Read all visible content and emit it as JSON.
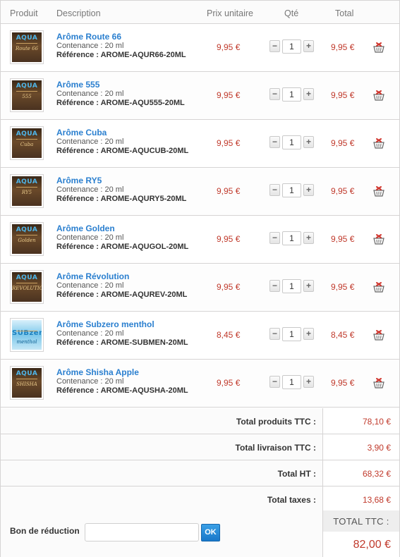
{
  "header": {
    "product": "Produit",
    "description": "Description",
    "unit_price": "Prix unitaire",
    "qty": "Qté",
    "total": "Total"
  },
  "labels": {
    "contenance_prefix": "Contenance : ",
    "reference_prefix": "Référence : "
  },
  "items": [
    {
      "name": "Arôme Route 66",
      "contenance": "20 ml",
      "reference": "AROME-AQUR66-20ML",
      "unit_price": "9,95 €",
      "qty": "1",
      "total": "9,95 €",
      "thumb_brand": "AQUA",
      "thumb_flavor": "Route 66"
    },
    {
      "name": "Arôme 555",
      "contenance": "20 ml",
      "reference": "AROME-AQU555-20ML",
      "unit_price": "9,95 €",
      "qty": "1",
      "total": "9,95 €",
      "thumb_brand": "AQUA",
      "thumb_flavor": "555"
    },
    {
      "name": "Arôme Cuba",
      "contenance": "20 ml",
      "reference": "AROME-AQUCUB-20ML",
      "unit_price": "9,95 €",
      "qty": "1",
      "total": "9,95 €",
      "thumb_brand": "AQUA",
      "thumb_flavor": "Cuba"
    },
    {
      "name": "Arôme RY5",
      "contenance": "20 ml",
      "reference": "AROME-AQURY5-20ML",
      "unit_price": "9,95 €",
      "qty": "1",
      "total": "9,95 €",
      "thumb_brand": "AQUA",
      "thumb_flavor": "RY5"
    },
    {
      "name": "Arôme Golden",
      "contenance": "20 ml",
      "reference": "AROME-AQUGOL-20ML",
      "unit_price": "9,95 €",
      "qty": "1",
      "total": "9,95 €",
      "thumb_brand": "AQUA",
      "thumb_flavor": "Golden"
    },
    {
      "name": "Arôme Révolution",
      "contenance": "20 ml",
      "reference": "AROME-AQUREV-20ML",
      "unit_price": "9,95 €",
      "qty": "1",
      "total": "9,95 €",
      "thumb_brand": "AQUA",
      "thumb_flavor": "REVOLUTION"
    },
    {
      "name": "Arôme Subzero menthol",
      "contenance": "20 ml",
      "reference": "AROME-SUBMEN-20ML",
      "unit_price": "8,45 €",
      "qty": "1",
      "total": "8,45 €",
      "thumb_brand": "SUBzero",
      "thumb_flavor": "menthol"
    },
    {
      "name": "Arôme Shisha Apple",
      "contenance": "20 ml",
      "reference": "AROME-AQUSHA-20ML",
      "unit_price": "9,95 €",
      "qty": "1",
      "total": "9,95 €",
      "thumb_brand": "AQUA",
      "thumb_flavor": "SHISHA"
    }
  ],
  "summary": [
    {
      "label": "Total produits TTC :",
      "value": "78,10 €"
    },
    {
      "label": "Total livraison TTC :",
      "value": "3,90 €"
    },
    {
      "label": "Total HT :",
      "value": "68,32 €"
    },
    {
      "label": "Total taxes :",
      "value": "13,68 €"
    }
  ],
  "discount": {
    "label": "Bon de réduction",
    "input_value": "",
    "button": "OK"
  },
  "grand_total": {
    "label": "TOTAL TTC :",
    "value": "82,00 €"
  },
  "colors": {
    "link": "#2a7fcf",
    "price": "#c0392b",
    "border": "#d6d4d4"
  }
}
